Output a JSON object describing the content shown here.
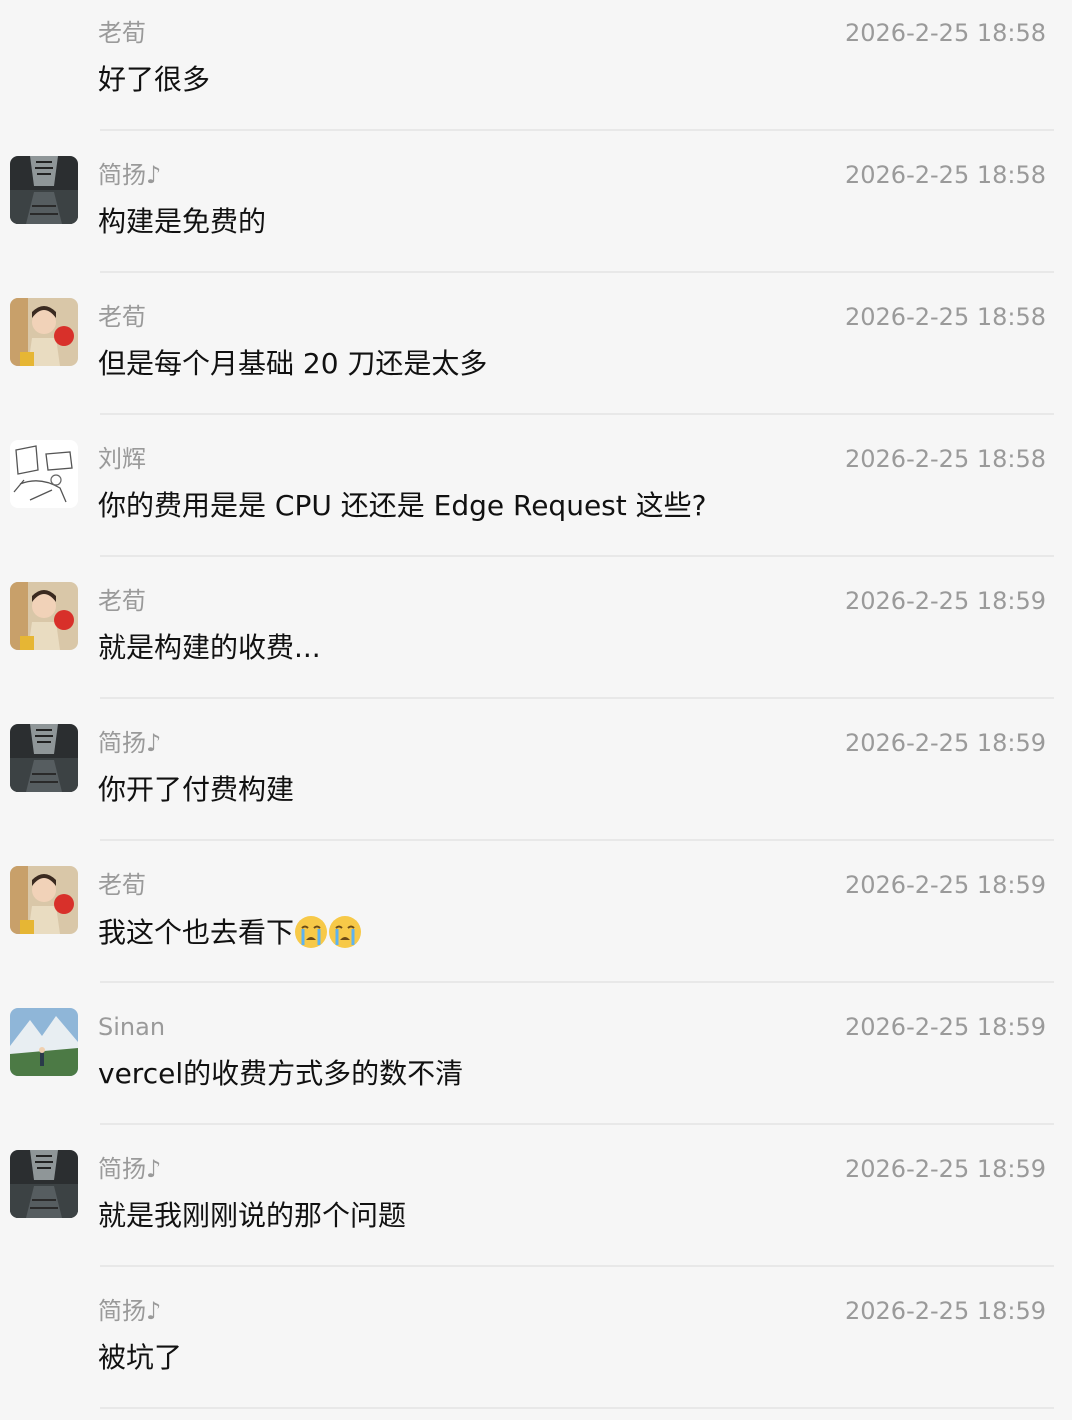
{
  "messages": [
    {
      "name": "老荀",
      "time": "2026-2-25 18:58",
      "text": "好了很多",
      "avatar": "none"
    },
    {
      "name": "简扬♪",
      "time": "2026-2-25 18:58",
      "text": "构建是免费的",
      "avatar": "tiger-avatar"
    },
    {
      "name": "老荀",
      "time": "2026-2-25 18:58",
      "text": "但是每个月基础 20 刀还是太多",
      "avatar": "girl-avatar"
    },
    {
      "name": "刘辉",
      "time": "2026-2-25 18:58",
      "text": "你的费用是是 CPU 还还是 Edge Request 这些?",
      "avatar": "sketch-avatar"
    },
    {
      "name": "老荀",
      "time": "2026-2-25 18:59",
      "text": "就是构建的收费...",
      "avatar": "girl-avatar"
    },
    {
      "name": "简扬♪",
      "time": "2026-2-25 18:59",
      "text": "你开了付费构建",
      "avatar": "tiger-avatar"
    },
    {
      "name": "老荀",
      "time": "2026-2-25 18:59",
      "text": "我这个也去看下",
      "emojis": [
        "crying-face-icon",
        "crying-face-icon"
      ],
      "avatar": "girl-avatar"
    },
    {
      "name": "Sinan",
      "time": "2026-2-25 18:59",
      "text": "vercel的收费方式多的数不清",
      "avatar": "mountain-avatar"
    },
    {
      "name": "简扬♪",
      "time": "2026-2-25 18:59",
      "text": "就是我刚刚说的那个问题",
      "avatar": "tiger-avatar"
    },
    {
      "name": "简扬♪",
      "time": "2026-2-25 18:59",
      "text": "被坑了",
      "avatar": "none"
    }
  ]
}
